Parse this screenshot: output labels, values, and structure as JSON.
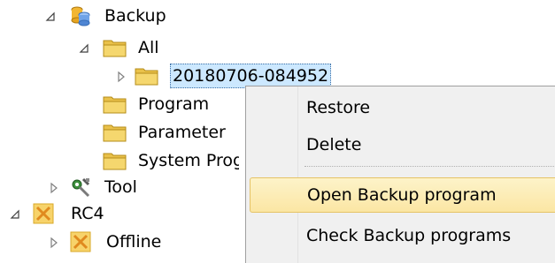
{
  "tree": {
    "backup_label": "Backup",
    "all_label": "All",
    "snapshot_label": "20180706-084952",
    "program_label": "Program",
    "parameter_label": "Parameter",
    "system_prog_label": "System Prog",
    "tool_label": "Tool",
    "rc4_label": "RC4",
    "offline_label": "Offline"
  },
  "context_menu": {
    "items": [
      {
        "label": "Restore"
      },
      {
        "label": "Delete"
      },
      {
        "label": "Open Backup program"
      },
      {
        "label": "Check Backup programs"
      }
    ]
  },
  "colors": {
    "selection": "#cce8ff",
    "folder": "#f5d76e",
    "menu_hover": "#fbe6a4"
  }
}
